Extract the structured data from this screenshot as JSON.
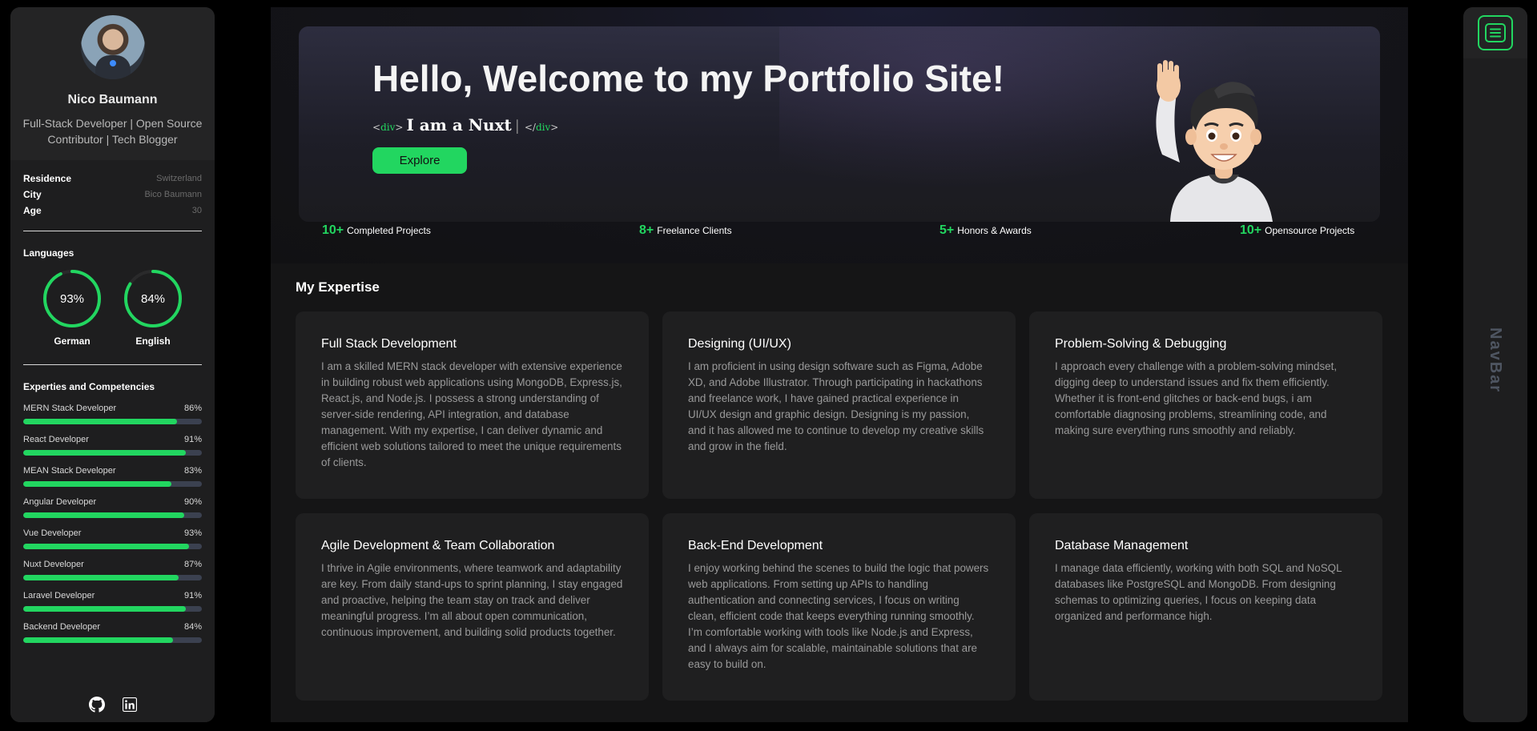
{
  "profile": {
    "name": "Nico Baumann",
    "role": "Full-Stack Developer | Open Source Contributor | Tech Blogger",
    "info": [
      {
        "label": "Residence",
        "value": "Switzerland"
      },
      {
        "label": "City",
        "value": "Bico Baumann"
      },
      {
        "label": "Age",
        "value": "30"
      }
    ]
  },
  "languages": {
    "title": "Languages",
    "items": [
      {
        "name": "German",
        "percent_label": "93%",
        "percent": 93
      },
      {
        "name": "English",
        "percent_label": "84%",
        "percent": 84
      }
    ]
  },
  "skills": {
    "title": "Experties and Competencies",
    "items": [
      {
        "name": "MERN Stack Developer",
        "percent_label": "86%",
        "percent": 86
      },
      {
        "name": "React Developer",
        "percent_label": "91%",
        "percent": 91
      },
      {
        "name": "MEAN Stack Developer",
        "percent_label": "83%",
        "percent": 83
      },
      {
        "name": "Angular Developer",
        "percent_label": "90%",
        "percent": 90
      },
      {
        "name": "Vue Developer",
        "percent_label": "93%",
        "percent": 93
      },
      {
        "name": "Nuxt Developer",
        "percent_label": "87%",
        "percent": 87
      },
      {
        "name": "Laravel Developer",
        "percent_label": "91%",
        "percent": 91
      },
      {
        "name": "Backend Developer",
        "percent_label": "84%",
        "percent": 84
      }
    ]
  },
  "social": {
    "icons": [
      "github-icon",
      "linkedin-icon"
    ]
  },
  "hero": {
    "title": "Hello, Welcome to my Portfolio Site!",
    "open_tag_left": "<",
    "open_tag_name": "div",
    "open_tag_right": ">",
    "typed_text": "I am a Nuxt",
    "caret": "|",
    "close_tag_left": "</",
    "close_tag_name": "div",
    "close_tag_right": ">",
    "explore_label": "Explore"
  },
  "stats": [
    {
      "number": "10+",
      "label": "Completed Projects"
    },
    {
      "number": "8+",
      "label": "Freelance Clients"
    },
    {
      "number": "5+",
      "label": "Honors & Awards"
    },
    {
      "number": "10+",
      "label": "Opensource Projects"
    }
  ],
  "expertise": {
    "title": "My Expertise",
    "cards": [
      {
        "title": "Full Stack Development",
        "text": "I am a skilled MERN stack developer with extensive experience in building robust web applications using MongoDB, Express.js, React.js, and Node.js. I possess a strong understanding of server-side rendering, API integration, and database management. With my expertise, I can deliver dynamic and efficient web solutions tailored to meet the unique requirements of clients."
      },
      {
        "title": "Designing (UI/UX)",
        "text": "I am proficient in using design software such as Figma, Adobe XD, and Adobe Illustrator. Through participating in hackathons and freelance work, I have gained practical experience in UI/UX design and graphic design. Designing is my passion, and it has allowed me to continue to develop my creative skills and grow in the field."
      },
      {
        "title": "Problem-Solving & Debugging",
        "text": "I approach every challenge with a problem-solving mindset, digging deep to understand issues and fix them efficiently. Whether it is front-end glitches or back-end bugs, i am comfortable diagnosing problems, streamlining code, and making sure everything runs smoothly and reliably."
      },
      {
        "title": "Agile Development & Team Collaboration",
        "text": "I thrive in Agile environments, where teamwork and adaptability are key. From daily stand-ups to sprint planning, I stay engaged and proactive, helping the team stay on track and deliver meaningful progress. I’m all about open communication, continuous improvement, and building solid products together."
      },
      {
        "title": "Back-End Development",
        "text": "I enjoy working behind the scenes to build the logic that powers web applications. From setting up APIs to handling authentication and connecting services, I focus on writing clean, efficient code that keeps everything running smoothly. I’m comfortable working with tools like Node.js and Express, and I always aim for scalable, maintainable solutions that are easy to build on."
      },
      {
        "title": "Database Management",
        "text": "I manage data efficiently, working with both SQL and NoSQL databases like PostgreSQL and MongoDB. From designing schemas to optimizing queries, I focus on keeping data organized and performance high."
      }
    ]
  },
  "nav": {
    "label": "NavBar",
    "menu_icon": "hamburger-menu-icon"
  },
  "colors": {
    "accent": "#22d660",
    "panel": "#1e1e1f",
    "card": "#1f1f20",
    "bar_track": "#3b4150"
  }
}
